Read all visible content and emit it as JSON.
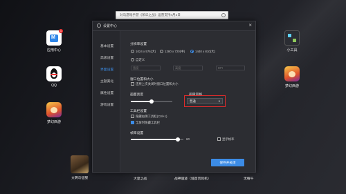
{
  "search": {
    "text": "对马游戏手游《荣华之战》运营支持4月2日"
  },
  "desktop_left": [
    {
      "label": "应用中心",
      "badge": "1"
    },
    {
      "label": "QQ"
    },
    {
      "label": "梦幻西游"
    }
  ],
  "desktop_right": [
    {
      "label": "小工具"
    },
    {
      "label": "梦幻西游"
    }
  ],
  "dock": [
    {
      "label": "文明与征服"
    },
    {
      "label": "大皇之战"
    },
    {
      "label": "战神遗迹（城首贯耳机）"
    },
    {
      "label": "无每午"
    }
  ],
  "dialog": {
    "title": "设置中心",
    "close": "×",
    "nav": [
      "基本设置",
      "高级设置",
      "界面设置",
      "主题美化",
      "属性设置",
      "游戏设置"
    ],
    "resolution_title": "分辨率设置",
    "resolutions": [
      "1024 x 576(大)",
      "1280 x 720(中)",
      "1440 x 810(大)"
    ],
    "custom_label": "自定义",
    "custom_fields": [
      "宽度",
      "高度",
      "DPI"
    ],
    "window_title": "窗口位置和大小",
    "window_option": "还原上次关闭时窗口位置和大小",
    "brightness_title": "画面亮度",
    "render_title": "画质风格",
    "render_value": "普通",
    "toolbar_title": "工具栏设置",
    "toolbar_options": [
      "隐藏右侧工具栏(Ctrl+1)",
      "全屏时隐藏工具栏"
    ],
    "fps_title": "帧率设置",
    "fps_value": "60",
    "fps_display": "显示帧率",
    "save_button": "保存并关闭"
  },
  "sliders": {
    "brightness": 0.5,
    "fps": 0.9
  },
  "colors": {
    "accent": "#3c8ce6",
    "highlight": "#e02b2b"
  }
}
